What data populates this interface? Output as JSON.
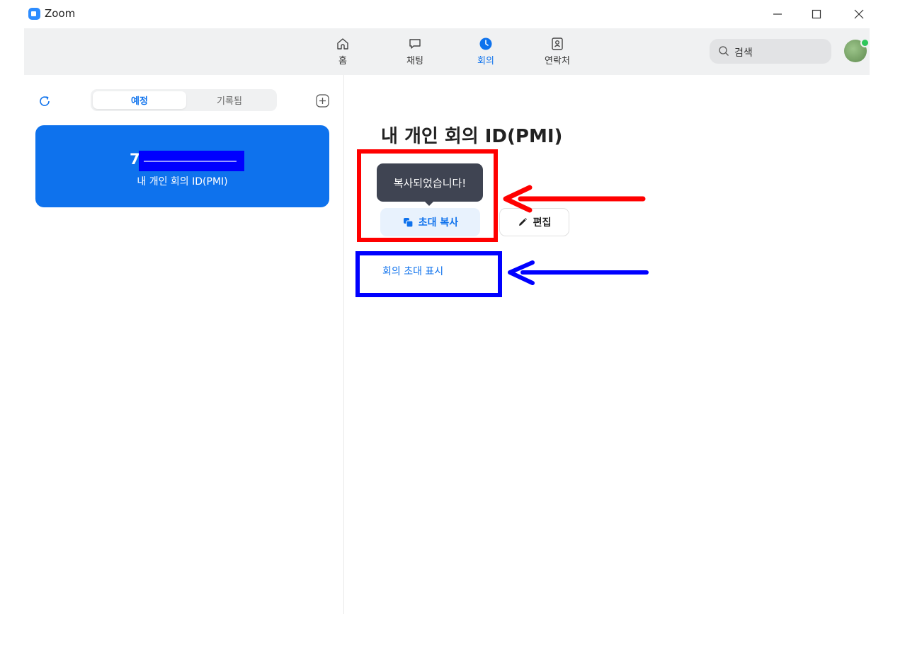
{
  "window": {
    "title": "Zoom"
  },
  "nav": {
    "items": [
      {
        "label": "홈",
        "icon": "home-icon"
      },
      {
        "label": "채팅",
        "icon": "chat-icon"
      },
      {
        "label": "회의",
        "icon": "meeting-clock-icon",
        "active": true
      },
      {
        "label": "연락처",
        "icon": "contacts-icon"
      }
    ],
    "search_label": "검색"
  },
  "sidebar": {
    "tabs": [
      {
        "label": "예정",
        "active": true
      },
      {
        "label": "기록됨",
        "active": false
      }
    ],
    "card": {
      "id_prefix": "7",
      "label": "내 개인 회의 ID(PMI)"
    }
  },
  "main": {
    "title": "내 개인 회의 ID(PMI)",
    "tooltip": "복사되었습니다!",
    "copy_button": "초대 복사",
    "edit_button": "편집",
    "show_invite_link": "회의 초대 표시"
  },
  "colors": {
    "accent": "#0e72ed",
    "annotation_red": "#ff0000",
    "annotation_blue": "#0000ff"
  }
}
